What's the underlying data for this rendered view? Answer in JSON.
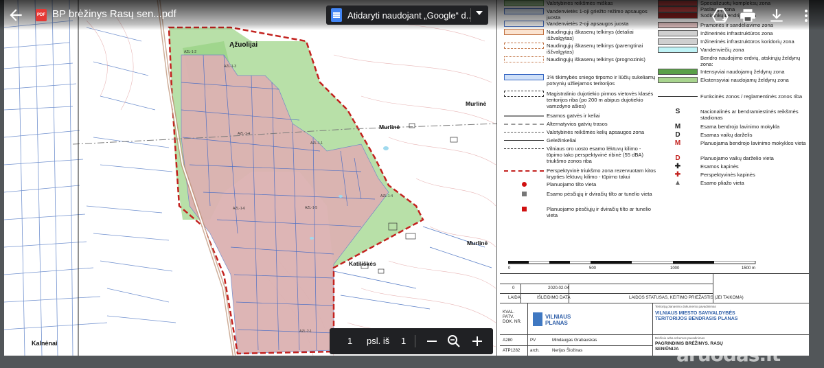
{
  "file": {
    "title": "BP brėžinys Rasų sen...pdf",
    "badge": "PDF"
  },
  "open_with": {
    "label": "Atidaryti naudojant „Google“ d..."
  },
  "icons": {
    "back": "arrow-left-icon",
    "docs": "google-docs-icon",
    "dropdown": "chevron-down-icon",
    "add_drive": "add-to-drive-icon",
    "print": "print-icon",
    "download": "download-icon",
    "more": "more-vert-icon",
    "zoom_out": "minus-icon",
    "zoom_fit": "zoom-icon",
    "zoom_in": "plus-icon"
  },
  "pager": {
    "current": "1",
    "label": "psl. iš",
    "total": "1"
  },
  "map": {
    "labels": {
      "azuolijai": "Ąžuolijai",
      "murline1": "Murlinė",
      "murline2": "Murlinė",
      "murline3": "Murlinė",
      "katiliskes": "Katiliškės",
      "kalnenai": "Kalnėnai",
      "zones": [
        "AZL-1-2",
        "AZL-1-4",
        "AZL-1-3",
        "AZL-1-6",
        "AZL-1-5",
        "AZL-1-1",
        "AZL-2-1",
        "AZL-1-4"
      ]
    }
  },
  "legend": {
    "left": [
      "Valstybinės reikšmės miškas",
      "Vandenvietės 1-oji griežto režimo apsaugos juosta",
      "Vandenvietės 2-oji apsaugos juosta",
      "Naudingųjų iškasenų telkinys (detaliai išžvalgytas)",
      "Naudingųjų iškasenų telkinys (parengtinai išžvalgytas)",
      "Naudingųjų iškasenų telkinys (prognozinis)",
      "1% tikimybės sniego tirpsmo ir liūčių sukeliamų potvynių užliejamos teritorijos",
      "Magistralinio dujotiekio pirmos vietovės klasės teritorijos riba (po 200 m abipus dujotiekio vamzdyno ašies)",
      "Esamos gatvės ir keliai",
      "Alternatyvios gatvių trasos",
      "Valstybinės reikšmės kelių apsaugos zona",
      "Geležinkeliai",
      "Vilniaus oro uosto esamo lėktuvų kilimo - tūpimo tako perspektyvinė ribinė (55 dBA) triukšmo zonos riba",
      "Perspektyvinė triukšmo zona rezervuotam kitos krypties lėktuvų kilimo - tūpimo takui",
      "Planuojamo tilto vieta",
      "Esamo pėsčiųjų ir dviračių tilto ar tunelio vieta",
      "Planuojamo pėsčiųjų ir dviračių tilto ar tunelio vieta"
    ],
    "right": [
      "Specializuotų kompleksų zona",
      "Paslaugų zona",
      "Sodininkų bendrijų zona",
      "Pramonės ir sandėliavimo zona",
      "Inžinerinės infrastruktūros zona",
      "Inžinerinės infrastruktūros koridorių zona",
      "Vandenviečių zona",
      "Bendro naudojimo erdvių, atskirųjų želdynų zona:",
      "Intensyviai naudojamų želdynų zona",
      "Ekstensyviai naudojamų želdynų zona",
      "Funkcinės zonos / reglamentinės zonos riba",
      "Nacionalinės ar bendramiestinės reikšmės stadionas",
      "Esama bendrojo lavinimo mokykla",
      "Esamas vaikų darželis",
      "Planuojama bendrojo lavinimo mokyklos vieta",
      "Planuojamo vaikų darželio vieta",
      "Esamos kapinės",
      "Perspektyvinės kapinės",
      "Esamo pliažo vieta"
    ],
    "right_marks": [
      "S",
      "M",
      "D",
      "M",
      "D",
      "✚",
      "✚",
      "▲"
    ],
    "colors": {
      "forest_green": "#b8e0a8",
      "intensive_green": "#5aa048",
      "extensive_green": "#a8d48e",
      "industry_pink": "#e9c6c6",
      "infra_grey": "#cfcfcf",
      "water_cyan": "#bff3f6",
      "services_red": "#d94a4a",
      "garden_dark": "#8a2020"
    }
  },
  "scale": {
    "ticks": [
      "0",
      "500",
      "1000",
      "1500 m"
    ]
  },
  "titleblock": {
    "rev_no": "0",
    "date": "2020.02.04",
    "col_laida": "LAIDA",
    "col_date": "IŠLEIDIMO DATA",
    "col_status": "LAIDOS STATUSAS, KEITIMO PRIEŽASTIS (JEI TAIKOMA)",
    "kval": "KVAL. PATV. DOK. NR.",
    "org": "VILNIAUS PLANAS",
    "project_small": "Teritorijų planavimo dokumento pavadinimas",
    "project": "VILNIAUS MIESTO SAVIVALDYBĖS TERITORIJOS BENDRASIS PLANAS",
    "sheet_small": "Brėžinio arba schemos pavadinimas",
    "sheet": "PAGRINDINIS BRĖŽINYS. RASŲ SENIŪNIJA",
    "staff": [
      {
        "code": "A280",
        "role": "PV",
        "name": "Mindaugas Grabauskas"
      },
      {
        "code": "ATP1282",
        "role": "arch.",
        "name": "Nerijus Šiožinas"
      }
    ]
  },
  "watermark": "aruodas.lt"
}
